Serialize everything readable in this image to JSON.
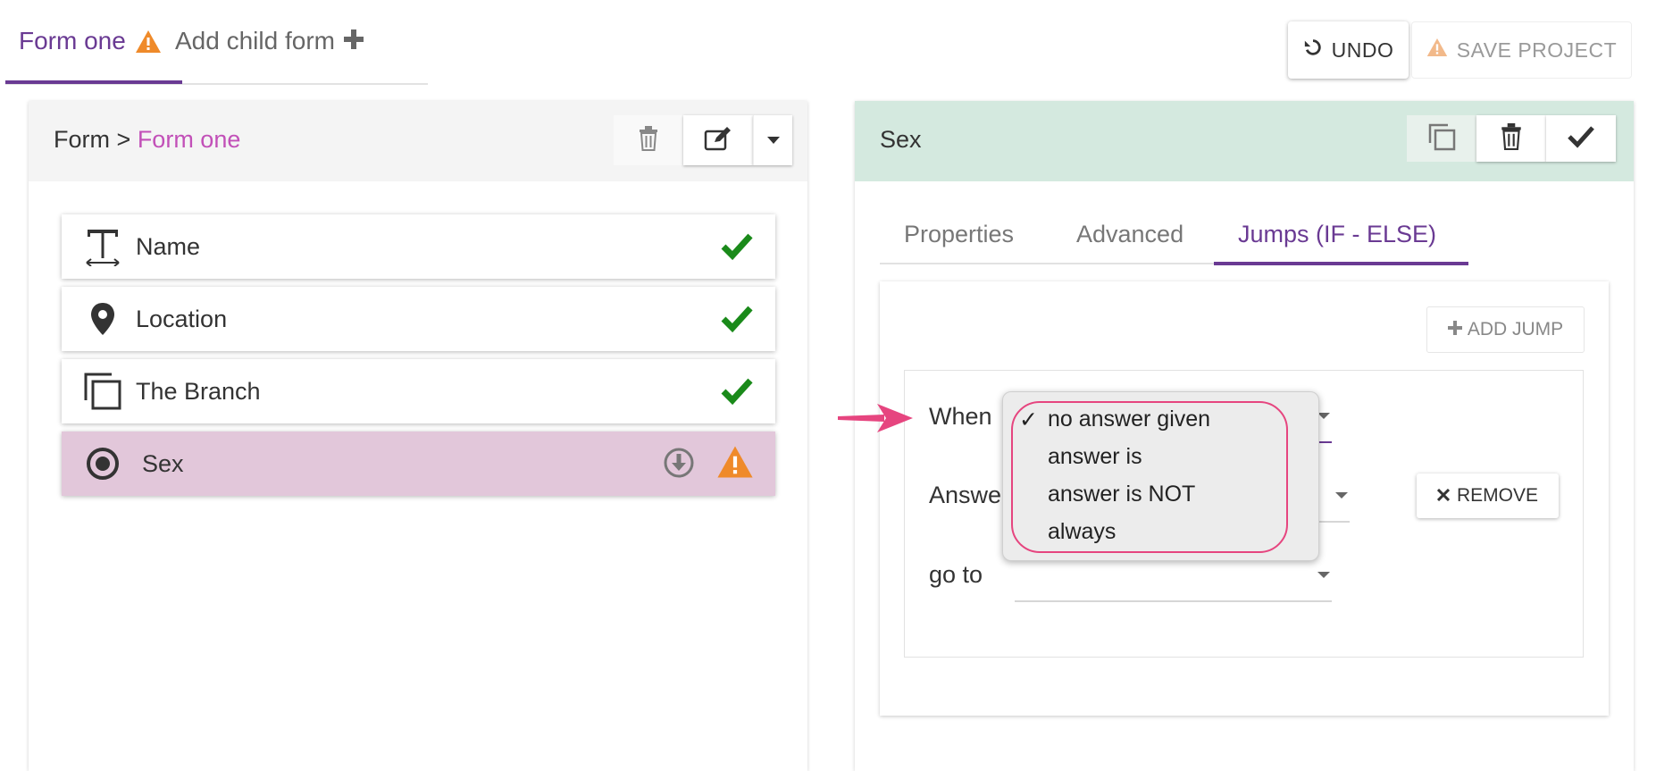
{
  "form_tabs": {
    "active_label": "Form one",
    "add_child_label": "Add child form"
  },
  "toolbar": {
    "undo_label": "UNDO",
    "save_label": "SAVE PROJECT"
  },
  "left_panel": {
    "breadcrumb_root": "Form",
    "breadcrumb_sep": ">",
    "breadcrumb_current": "Form one",
    "questions": [
      {
        "label": "Name",
        "icon": "text-type-icon",
        "status": "valid"
      },
      {
        "label": "Location",
        "icon": "location-pin-icon",
        "status": "valid"
      },
      {
        "label": "The Branch",
        "icon": "branch-copy-icon",
        "status": "valid"
      },
      {
        "label": "Sex",
        "icon": "radio-icon",
        "status": "warning",
        "selected": true
      }
    ]
  },
  "right_panel": {
    "title": "Sex",
    "tabs": [
      "Properties",
      "Advanced",
      "Jumps (IF - ELSE)"
    ],
    "active_tab": "Jumps (IF - ELSE)",
    "add_jump_label": "ADD JUMP",
    "jump": {
      "when_label": "When",
      "answer_label": "Answe",
      "goto_label": "go to",
      "remove_label": "REMOVE"
    }
  },
  "dropdown": {
    "options": [
      "no answer given",
      "answer is",
      "answer is NOT",
      "always"
    ],
    "selected": "no answer given",
    "check_mark": "✓"
  },
  "colors": {
    "accent_purple": "#6a3a93",
    "breadcrumb_pink": "#c250b8",
    "selected_row": "#e2c7da",
    "success_green": "#1a8a1a",
    "warning_orange": "#ef8a2a",
    "highlight_pink": "#e6457f"
  }
}
